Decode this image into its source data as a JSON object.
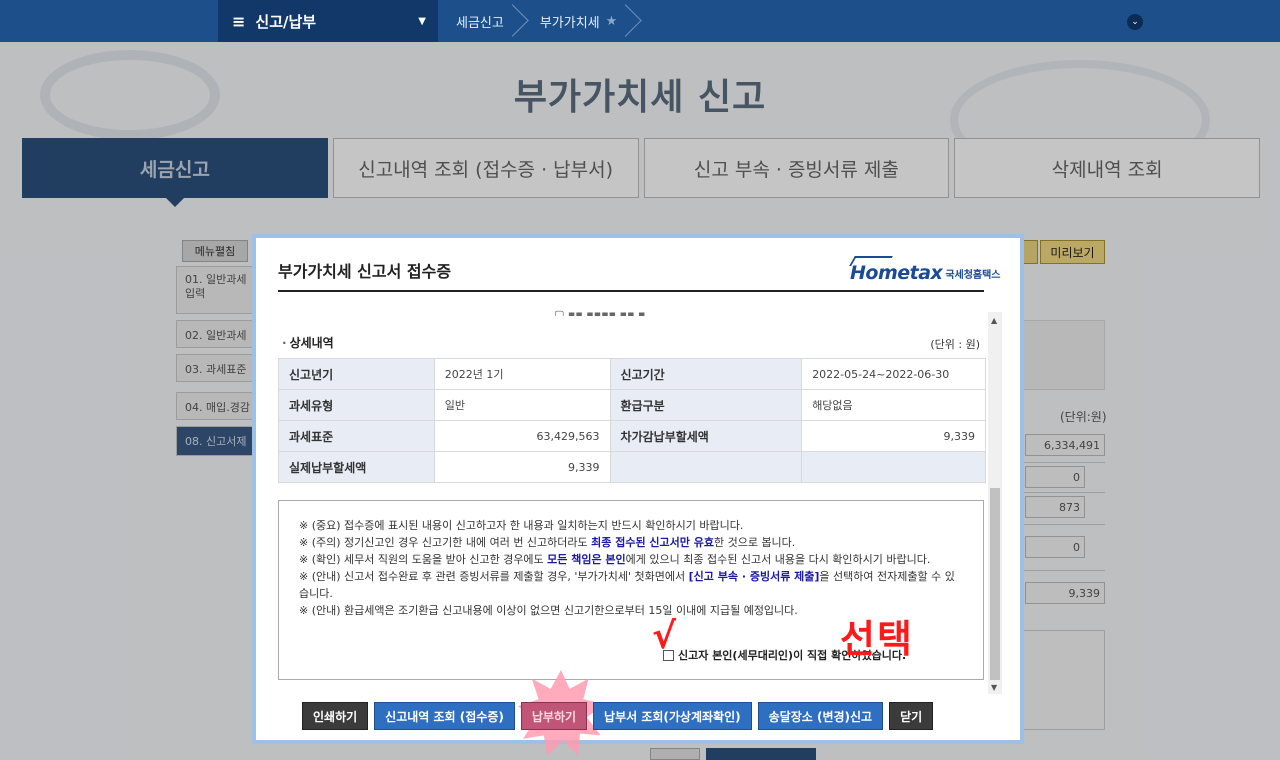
{
  "topnav": {
    "menu_label": "신고/납부",
    "crumbs": [
      "세금신고",
      "부가가치세"
    ]
  },
  "page": {
    "title": "부가가치세 신고",
    "tabs": [
      "세금신고",
      "신고내역 조회 (접수증 · 납부서)",
      "신고 부속 · 증빙서류 제출",
      "삭제내역 조회"
    ]
  },
  "sidebar": {
    "menu_edit": "메뉴펼침",
    "items": [
      "01. 일반과세 입력",
      "02. 일반과세",
      "03. 과세표준",
      "04. 매입.경감",
      "08. 신고서제"
    ]
  },
  "right": {
    "preview": "미리보기",
    "unit": "(단위:원)",
    "values": [
      "6,334,491",
      "0",
      "873",
      "0",
      "9,339"
    ]
  },
  "modal": {
    "title": "부가가치세 신고서 접수증",
    "logo_home": "Hometax",
    "logo_kr": "국세청홈택스",
    "section_title": "상세내역",
    "unit": "(단위 : 원)",
    "rows": [
      {
        "h1": "신고년기",
        "v1": "2022년 1기",
        "h2": "신고기간",
        "v2": "2022-05-24~2022-06-30"
      },
      {
        "h1": "과세유형",
        "v1": "일반",
        "h2": "환급구분",
        "v2": "해당없음"
      },
      {
        "h1": "과세표준",
        "v1": "63,429,563",
        "h2": "차가감납부할세액",
        "v2": "9,339"
      },
      {
        "h1": "실제납부할세액",
        "v1": "9,339",
        "h2": "",
        "v2": ""
      }
    ],
    "notice": {
      "l1": "※ (중요) 접수증에 표시된 내용이 신고하고자 한 내용과 일치하는지 반드시 확인하시기 바랍니다.",
      "l2a": "※ (주의) 정기신고인 경우 신고기한 내에 여러 번 신고하더라도 ",
      "l2b": "최종 접수된 신고서만 유효",
      "l2c": "한 것으로 봅니다.",
      "l3a": "※ (확인) 세무서 직원의 도움을 받아 신고한 경우에도 ",
      "l3b": "모든 책임은 본인",
      "l3c": "에게 있으니 최종 접수된 신고서 내용을 다시 확인하시기 바랍니다.",
      "l4a": "※ (안내) 신고서 접수완료 후 관련 증빙서류를 제출할 경우, '부가가치세' 첫화면에서 ",
      "l4b": "[신고 부속 · 증빙서류 제출]",
      "l4c": "을 선택하여 전자제출할 수 있습니다.",
      "l5": "※ (안내) 환급세액은 조기환급 신고내용에 이상이 없으면 신고기한으로부터 15일 이내에 지급될 예정입니다.",
      "confirm": "신고자 본인(세무대리인)이 직접 확인하였습니다."
    },
    "annotations": {
      "check": "√",
      "select": "선택"
    },
    "buttons": [
      "인쇄하기",
      "신고내역 조회 (접수증)",
      "납부하기",
      "납부서 조회(가상계좌확인)",
      "송달장소 (변경)신고",
      "닫기"
    ]
  }
}
